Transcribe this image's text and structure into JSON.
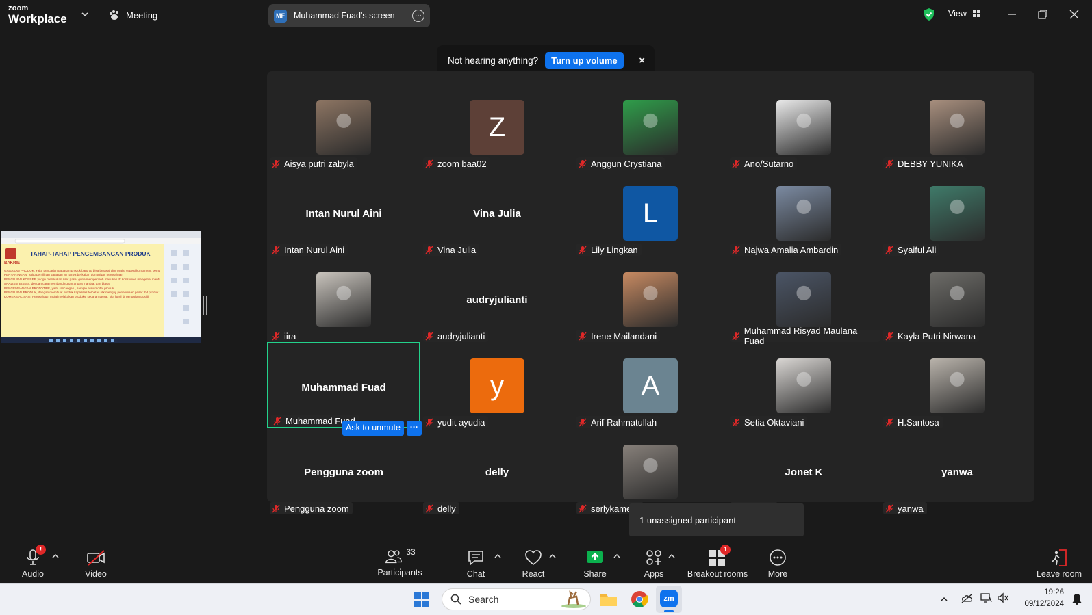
{
  "app": {
    "brand_top": "zoom",
    "brand_bottom": "Workplace",
    "meeting_label": "Meeting",
    "view_label": "View"
  },
  "screen_pill": {
    "badge": "MF",
    "label": "Muhammad Fuad's screen"
  },
  "toast": {
    "message": "Not hearing anything?",
    "button": "Turn up volume",
    "close": "×"
  },
  "shared_screen": {
    "slide_title": "TAHAP-TAHAP PENGEMBANGAN PRODUK",
    "logo_text": "BAKRIE",
    "bullets": [
      "GAGASAN PRODUK, Yaitu pencarian gagasan produk baru yg bisa berasal dimn saja, seperti konsumen, pemasok, dsnya",
      "PENYARINGAN, Yaitu pemilihan gagasan yg hanya berkaitan dgn tujuan perusahaan",
      "PENGUJIAN KONSEP, yi dgn melakukan riset pasar guna memperoleh masukan dr konsumen mengenai manfaat dan harga",
      "ANALISIS BISNIS, dengan cara membandingkan antara manfaat dan biaya",
      "PENGEMBANGAN PROTOTIPE, yaitu rancangan , sample atau model produk",
      "PENGUJIAN PRODUK, dengan membuat produk kapasitas terbatas utk menguji penerimaan pasar thd produk tsb",
      "KOMERSIALISASI, Perusahaan mulai melakukan produksi secara massal, bila hasil dr pengujian positif"
    ]
  },
  "participants": [
    {
      "name": "Aisya putri zabyla",
      "display": "photo",
      "photo_tone": "#8d7563"
    },
    {
      "name": "zoom baa02",
      "display": "letter",
      "letter": "Z",
      "color": "#5d4037"
    },
    {
      "name": "Anggun Crystiana",
      "display": "photo",
      "photo_tone": "#2f9d4a"
    },
    {
      "name": "Ano/Sutarno",
      "display": "photo",
      "photo_tone": "#e9e9e9"
    },
    {
      "name": "DEBBY YUNIKA",
      "display": "photo",
      "photo_tone": "#a88f7e"
    },
    {
      "name": "Intan Nurul Aini",
      "display": "name"
    },
    {
      "name": "Vina Julia",
      "display": "name"
    },
    {
      "name": "Lily Lingkan",
      "display": "letter",
      "letter": "L",
      "color": "#0f57a3"
    },
    {
      "name": "Najwa Amalia Ambardin",
      "display": "photo",
      "photo_tone": "#7b8aa1"
    },
    {
      "name": "Syaiful Ali",
      "display": "photo",
      "photo_tone": "#3f7a69"
    },
    {
      "name": "iira",
      "display": "photo",
      "photo_tone": "#c9c4bd"
    },
    {
      "name": "audryjulianti",
      "display": "name"
    },
    {
      "name": "Irene Mailandani",
      "display": "photo",
      "photo_tone": "#c78a62"
    },
    {
      "name": "Muhammad Risyad Maulana Fuad",
      "display": "photo",
      "photo_tone": "#4b5566"
    },
    {
      "name": "Kayla Putri Nirwana",
      "display": "photo",
      "photo_tone": "#6d6c68"
    },
    {
      "name": "Muhammad Fuad",
      "display": "name",
      "active": true
    },
    {
      "name": "yudit ayudia",
      "display": "letter",
      "letter": "y",
      "color": "#ec6b0d"
    },
    {
      "name": "Arif Rahmatullah",
      "display": "letter",
      "letter": "A",
      "color": "#6b8491"
    },
    {
      "name": "Setia Oktaviani",
      "display": "photo",
      "photo_tone": "#d9d6d3"
    },
    {
      "name": "H.Santosa",
      "display": "photo",
      "photo_tone": "#b9b3ab"
    },
    {
      "name": "Pengguna zoom",
      "display": "name"
    },
    {
      "name": "delly",
      "display": "name"
    },
    {
      "name": "serlykamelia",
      "display": "photo",
      "photo_tone": "#87807a"
    },
    {
      "name": "Jonet K",
      "display": "name"
    },
    {
      "name": "yanwa",
      "display": "name"
    }
  ],
  "ask_to_unmute": {
    "label": "Ask to unmute",
    "more": "···"
  },
  "unassigned": "1 unassigned participant",
  "toolbar": {
    "audio": {
      "label": "Audio",
      "badge": "!"
    },
    "video": {
      "label": "Video"
    },
    "participants": {
      "label": "Participants",
      "count": "33"
    },
    "chat": {
      "label": "Chat"
    },
    "react": {
      "label": "React"
    },
    "share": {
      "label": "Share"
    },
    "apps": {
      "label": "Apps"
    },
    "breakout": {
      "label": "Breakout rooms",
      "badge": "1"
    },
    "more": {
      "label": "More"
    },
    "leave": {
      "label": "Leave room"
    }
  },
  "taskbar": {
    "search_placeholder": "Search",
    "time": "19:26",
    "date": "09/12/2024",
    "zoom_icon": "zm"
  },
  "colors": {
    "accent": "#0e72ed",
    "active_speaker": "#23d18b",
    "mute": "#e02828",
    "share_green": "#0bb14e"
  }
}
